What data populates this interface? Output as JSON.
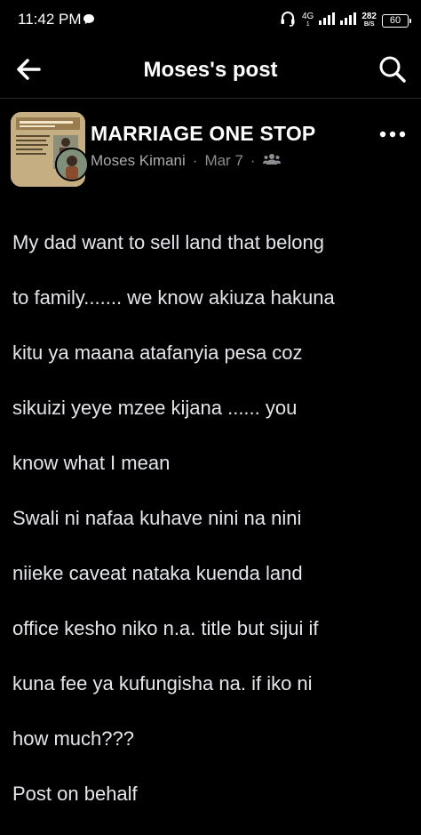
{
  "status_bar": {
    "time": "11:42 PM",
    "network_type": "4G",
    "network_sub": "1",
    "speed_value": "282",
    "speed_unit": "B/S",
    "battery_level": "60",
    "icons": [
      "chat-bubble-icon",
      "headset-icon",
      "signal-icon",
      "battery-icon"
    ]
  },
  "header": {
    "title": "Moses's post",
    "back_icon": "arrow-left-icon",
    "search_icon": "search-icon"
  },
  "post": {
    "group_name": "MARRIAGE ONE STOP",
    "author": "Moses Kimani",
    "separator": "·",
    "date": "Mar 7",
    "audience_icon": "group-members-icon",
    "more_icon": "more-dots-icon",
    "body_lines": [
      "My dad want to sell land that belong",
      "to family....... we know akiuza hakuna",
      "kitu ya maana atafanyia pesa coz",
      "sikuizi yeye mzee  kijana  ...... you",
      "know what I mean",
      "Swali ni nafaa kuhave nini na  nini",
      "niieke caveat nataka kuenda land",
      "office kesho niko n.a. title but sijui if",
      "kuna fee ya kufungisha na. if iko  ni",
      "how much???",
      "Post on behalf"
    ]
  },
  "colors": {
    "background": "#000000",
    "primary_text": "#e4e6eb",
    "secondary_text": "#8a8d91",
    "title_text": "#ffffff"
  }
}
